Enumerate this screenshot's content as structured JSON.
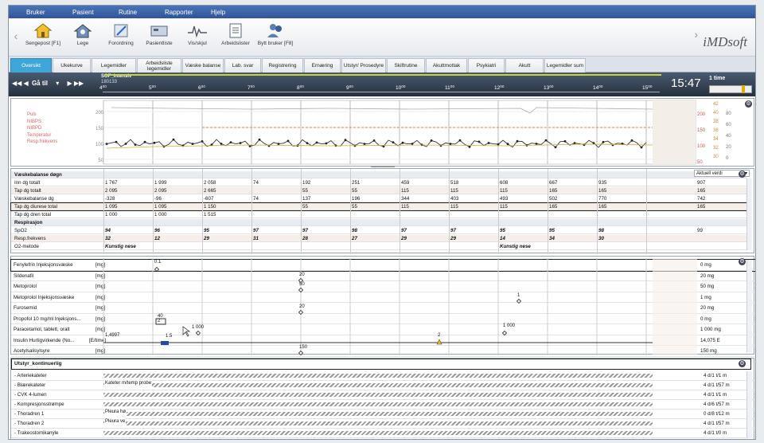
{
  "menu": [
    "Bruker",
    "Pasient",
    "Rutine",
    "Rapporter",
    "Hjelp"
  ],
  "toolbar": [
    {
      "label": "Sengepost [F1]",
      "icon": "house-icon"
    },
    {
      "label": "Lege",
      "icon": "doctor-house-icon"
    },
    {
      "label": "Forordning",
      "icon": "pen-icon"
    },
    {
      "label": "Pasientliste",
      "icon": "patient-list-icon"
    },
    {
      "label": "Vis/skjul",
      "icon": "waveform-icon"
    },
    {
      "label": "Arbeidslister",
      "icon": "worklist-icon"
    },
    {
      "label": "Bytt bruker [F8]",
      "icon": "switch-user-icon"
    }
  ],
  "brand": "iMDsoft",
  "tabs": [
    "Oversikt",
    "Ukekurve",
    "Legemidler",
    "Arbeidsliste legemidler",
    "Væske balanse",
    "Lab. svar",
    "Registrering",
    "Ernæring",
    "Utstyr/ Prosedyre",
    "Skiftrutine",
    "Akuttmottak",
    "Psykiatri",
    "Akutt",
    "Legemidler sum"
  ],
  "timeline": {
    "goto": "Gå til",
    "patient": "SOF_Intensiv",
    "patient_sub": "180133",
    "hours": [
      "4⁰⁰",
      "5⁰⁰",
      "6⁰⁰",
      "7⁰⁰",
      "8⁰⁰",
      "9⁰⁰",
      "10⁰⁰",
      "11⁰⁰",
      "12⁰⁰",
      "13⁰⁰",
      "14⁰⁰",
      "15⁰⁰"
    ],
    "clock": "15:47",
    "zoom": "1 time"
  },
  "vitals": {
    "legend": [
      "Puls",
      "NIBPS",
      "NIBPD",
      "Temperatur",
      "Resp.frekvens"
    ],
    "left_ticks": [
      "200",
      "150",
      "100",
      "50"
    ],
    "right_ticks1": [
      "200",
      "150",
      "100",
      "50"
    ],
    "right_ticks2": [
      "42",
      "40",
      "38",
      "36",
      "34",
      "32",
      "30"
    ],
    "right_ticks3": [
      "80",
      "60",
      "40",
      "20",
      "0"
    ]
  },
  "fluid": {
    "current_label": "Aktuell verdi",
    "rows": [
      {
        "label": "Væskebalanse døgn",
        "cells": [
          "",
          "",
          "",
          "",
          "",
          "",
          "",
          "",
          "",
          "",
          "",
          ""
        ],
        "cur": "",
        "header": true
      },
      {
        "label": "Inn dg totalt",
        "cells": [
          "1 767",
          "1 999",
          "2 058",
          "74",
          "192",
          "251",
          "459",
          "518",
          "608",
          "667",
          "935"
        ],
        "cur": "907"
      },
      {
        "label": "Tap dg totalt",
        "cells": [
          "2 095",
          "2 095",
          "2 665",
          "",
          "55",
          "55",
          "115",
          "115",
          "115",
          "165",
          "165"
        ],
        "cur": "165"
      },
      {
        "label": "Væskebalanse dg",
        "cells": [
          "-328",
          "-96",
          "-607",
          "74",
          "137",
          "196",
          "344",
          "403",
          "493",
          "502",
          "770"
        ],
        "cur": "742"
      },
      {
        "label": "Tap dg diurese total",
        "cells": [
          "1 095",
          "1 095",
          "1 150",
          "",
          "55",
          "55",
          "115",
          "115",
          "115",
          "165",
          "165"
        ],
        "cur": "165"
      },
      {
        "label": "Tap dg dren total",
        "cells": [
          "1 000",
          "1 000",
          "1 515",
          "",
          "",
          "",
          "",
          "",
          "",
          "",
          ""
        ],
        "cur": ""
      },
      {
        "label": "Respirasjon",
        "cells": [
          "",
          "",
          "",
          "",
          "",
          "",
          "",
          "",
          "",
          "",
          ""
        ],
        "cur": "",
        "header": true
      },
      {
        "label": "SpO2",
        "cells": [
          "94",
          "96",
          "95",
          "97",
          "97",
          "98",
          "97",
          "97",
          "95",
          "95",
          "98"
        ],
        "cur": "99"
      },
      {
        "label": "Resp.frekvens",
        "cells": [
          "32",
          "12",
          "29",
          "31",
          "28",
          "27",
          "29",
          "29",
          "14",
          "34",
          "30"
        ],
        "cur": ""
      },
      {
        "label": "O2-metode",
        "cells": [
          "Kunstig nese",
          "",
          "",
          "",
          "",
          "",
          "",
          "",
          "Kunstig nese",
          "",
          ""
        ],
        "cur": ""
      }
    ]
  },
  "meds": [
    {
      "label": "Fenylefrin Injeksjonsvæske",
      "unit": "[mg]",
      "cur": "0 mg"
    },
    {
      "label": "Sildenafil",
      "unit": "[mg]",
      "cur": "20 mg"
    },
    {
      "label": "Metoprolol",
      "unit": "[mg]",
      "cur": "50 mg"
    },
    {
      "label": "Metoprolol Injeksjonsvæske",
      "unit": "[mg]",
      "cur": "1 mg"
    },
    {
      "label": "Furosemid",
      "unit": "[mg]",
      "cur": "20 mg"
    },
    {
      "label": "Propofol 10 mg/ml Injeksjons...",
      "unit": "[mg]",
      "cur": "0 mg"
    },
    {
      "label": "Paracetamol, tablett, oralt",
      "unit": "[mg]",
      "cur": "1 000 mg"
    },
    {
      "label": "Insulin Hurtigvirkende (No...",
      "unit": "[E/time]",
      "cur": "14,075 E"
    },
    {
      "label": "Acetylsalisylsyre",
      "unit": "[mg]",
      "cur": "150 mg"
    }
  ],
  "med_marks": [
    "0.1",
    "20",
    "50",
    "1",
    "20",
    "40",
    "2",
    "1 000",
    "1 000",
    "1,4997",
    "1.5",
    "2",
    "150"
  ],
  "equip": {
    "title": "Utstyr_kontinuerlig",
    "rows": [
      {
        "label": "- Arteriekateter",
        "note": "",
        "cur": "4 d/1 t/1 m"
      },
      {
        "label": "- Blærekateter",
        "note": "Kateter m/temp probe",
        "cur": "4 d/1 t/57 m"
      },
      {
        "label": "- CVK 4-lumen",
        "note": "",
        "cur": "4 d/1 t/1 m"
      },
      {
        "label": "- Kompresjonsstrømpe",
        "note": "",
        "cur": "4 d/6 t/57 m"
      },
      {
        "label": "- Thoradren 1",
        "note": "Pleura hø",
        "cur": "0 d/8 t/12 m"
      },
      {
        "label": "- Thoradren 2",
        "note": "Pleura ve",
        "cur": "4 d/1 t/57 m"
      },
      {
        "label": "- Trakeostomikanyle",
        "note": "",
        "cur": "4 d/1 t/0 m"
      }
    ]
  }
}
